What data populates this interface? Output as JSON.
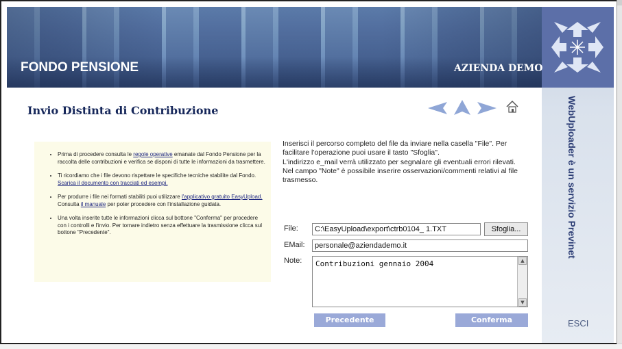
{
  "header": {
    "app_title": "FONDO PENSIONE",
    "company": "AZIENDA DEMO"
  },
  "page": {
    "title": "Invio Distinta di Contribuzione"
  },
  "nav_icons": [
    "back-arrow-icon",
    "up-arrow-icon",
    "forward-arrow-icon",
    "home-icon"
  ],
  "side": {
    "vertical_text": "WebUploader è un servizio Previnet",
    "exit_label": "ESCI"
  },
  "tips": {
    "t1_pre": "Prima di procedere consulta le ",
    "t1_link": "regole operative",
    "t1_post": " emanate dal Fondo Pensione per la raccolta delle contribuzioni e verifica se disponi di tutte le informazioni da trasmettere.",
    "t2_pre": "Ti ricordiamo che i file devono rispettare le specifiche tecniche stabilite dal Fondo. ",
    "t2_link": "Scarica il documento con tracciati ed esempi.",
    "t3_pre": "Per produrre i file nei formati stabiliti puoi utilizzare ",
    "t3_link1": "l'applicativo gratuito EasyUpload.",
    "t3_mid": " Consulta ",
    "t3_link2": "il manuale",
    "t3_post": " per poter procedere con l'installazione guidata.",
    "t4": "Una volta inserite tutte le informazioni clicca sul bottone \"Conferma\" per procedere con i controlli e l'invio. Per tornare indietro senza effettuare la trasmissione clicca sul bottone \"Precedente\"."
  },
  "instructions": {
    "p1": "Inserisci il percorso completo del file da inviare nella casella \"File\". Per facilitare l'operazione puoi usare il tasto \"Sfoglia\".",
    "p2": "L'indirizzo e_mail verrà utilizzato per segnalare gli eventuali errori rilevati.",
    "p3": "Nel campo \"Note\" è possibile inserire osservazioni/commenti relativi al file trasmesso."
  },
  "form": {
    "file_label": "File:",
    "file_value": "C:\\EasyUpload\\export\\ctrb0104_ 1.TXT",
    "browse_label": "Sfoglia...",
    "email_label": "EMail:",
    "email_value": "personale@aziendademo.it",
    "note_label": "Note:",
    "note_value": "Contribuzioni gennaio 2004",
    "prev_label": "Precedente",
    "confirm_label": "Conferma"
  },
  "colors": {
    "title": "#16275a",
    "button": "#9aa9d8",
    "tips_bg": "#fcfbe8",
    "logo": "#5c6fa8"
  }
}
